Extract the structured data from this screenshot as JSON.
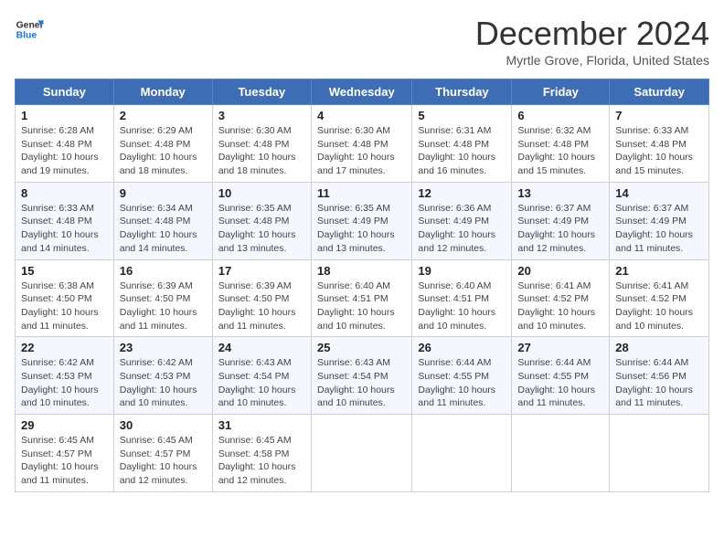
{
  "logo": {
    "line1": "General",
    "line2": "Blue"
  },
  "title": "December 2024",
  "location": "Myrtle Grove, Florida, United States",
  "days_of_week": [
    "Sunday",
    "Monday",
    "Tuesday",
    "Wednesday",
    "Thursday",
    "Friday",
    "Saturday"
  ],
  "weeks": [
    [
      {
        "day": "1",
        "info": "Sunrise: 6:28 AM\nSunset: 4:48 PM\nDaylight: 10 hours\nand 19 minutes."
      },
      {
        "day": "2",
        "info": "Sunrise: 6:29 AM\nSunset: 4:48 PM\nDaylight: 10 hours\nand 18 minutes."
      },
      {
        "day": "3",
        "info": "Sunrise: 6:30 AM\nSunset: 4:48 PM\nDaylight: 10 hours\nand 18 minutes."
      },
      {
        "day": "4",
        "info": "Sunrise: 6:30 AM\nSunset: 4:48 PM\nDaylight: 10 hours\nand 17 minutes."
      },
      {
        "day": "5",
        "info": "Sunrise: 6:31 AM\nSunset: 4:48 PM\nDaylight: 10 hours\nand 16 minutes."
      },
      {
        "day": "6",
        "info": "Sunrise: 6:32 AM\nSunset: 4:48 PM\nDaylight: 10 hours\nand 15 minutes."
      },
      {
        "day": "7",
        "info": "Sunrise: 6:33 AM\nSunset: 4:48 PM\nDaylight: 10 hours\nand 15 minutes."
      }
    ],
    [
      {
        "day": "8",
        "info": "Sunrise: 6:33 AM\nSunset: 4:48 PM\nDaylight: 10 hours\nand 14 minutes."
      },
      {
        "day": "9",
        "info": "Sunrise: 6:34 AM\nSunset: 4:48 PM\nDaylight: 10 hours\nand 14 minutes."
      },
      {
        "day": "10",
        "info": "Sunrise: 6:35 AM\nSunset: 4:48 PM\nDaylight: 10 hours\nand 13 minutes."
      },
      {
        "day": "11",
        "info": "Sunrise: 6:35 AM\nSunset: 4:49 PM\nDaylight: 10 hours\nand 13 minutes."
      },
      {
        "day": "12",
        "info": "Sunrise: 6:36 AM\nSunset: 4:49 PM\nDaylight: 10 hours\nand 12 minutes."
      },
      {
        "day": "13",
        "info": "Sunrise: 6:37 AM\nSunset: 4:49 PM\nDaylight: 10 hours\nand 12 minutes."
      },
      {
        "day": "14",
        "info": "Sunrise: 6:37 AM\nSunset: 4:49 PM\nDaylight: 10 hours\nand 11 minutes."
      }
    ],
    [
      {
        "day": "15",
        "info": "Sunrise: 6:38 AM\nSunset: 4:50 PM\nDaylight: 10 hours\nand 11 minutes."
      },
      {
        "day": "16",
        "info": "Sunrise: 6:39 AM\nSunset: 4:50 PM\nDaylight: 10 hours\nand 11 minutes."
      },
      {
        "day": "17",
        "info": "Sunrise: 6:39 AM\nSunset: 4:50 PM\nDaylight: 10 hours\nand 11 minutes."
      },
      {
        "day": "18",
        "info": "Sunrise: 6:40 AM\nSunset: 4:51 PM\nDaylight: 10 hours\nand 10 minutes."
      },
      {
        "day": "19",
        "info": "Sunrise: 6:40 AM\nSunset: 4:51 PM\nDaylight: 10 hours\nand 10 minutes."
      },
      {
        "day": "20",
        "info": "Sunrise: 6:41 AM\nSunset: 4:52 PM\nDaylight: 10 hours\nand 10 minutes."
      },
      {
        "day": "21",
        "info": "Sunrise: 6:41 AM\nSunset: 4:52 PM\nDaylight: 10 hours\nand 10 minutes."
      }
    ],
    [
      {
        "day": "22",
        "info": "Sunrise: 6:42 AM\nSunset: 4:53 PM\nDaylight: 10 hours\nand 10 minutes."
      },
      {
        "day": "23",
        "info": "Sunrise: 6:42 AM\nSunset: 4:53 PM\nDaylight: 10 hours\nand 10 minutes."
      },
      {
        "day": "24",
        "info": "Sunrise: 6:43 AM\nSunset: 4:54 PM\nDaylight: 10 hours\nand 10 minutes."
      },
      {
        "day": "25",
        "info": "Sunrise: 6:43 AM\nSunset: 4:54 PM\nDaylight: 10 hours\nand 10 minutes."
      },
      {
        "day": "26",
        "info": "Sunrise: 6:44 AM\nSunset: 4:55 PM\nDaylight: 10 hours\nand 11 minutes."
      },
      {
        "day": "27",
        "info": "Sunrise: 6:44 AM\nSunset: 4:55 PM\nDaylight: 10 hours\nand 11 minutes."
      },
      {
        "day": "28",
        "info": "Sunrise: 6:44 AM\nSunset: 4:56 PM\nDaylight: 10 hours\nand 11 minutes."
      }
    ],
    [
      {
        "day": "29",
        "info": "Sunrise: 6:45 AM\nSunset: 4:57 PM\nDaylight: 10 hours\nand 11 minutes."
      },
      {
        "day": "30",
        "info": "Sunrise: 6:45 AM\nSunset: 4:57 PM\nDaylight: 10 hours\nand 12 minutes."
      },
      {
        "day": "31",
        "info": "Sunrise: 6:45 AM\nSunset: 4:58 PM\nDaylight: 10 hours\nand 12 minutes."
      },
      null,
      null,
      null,
      null
    ]
  ]
}
